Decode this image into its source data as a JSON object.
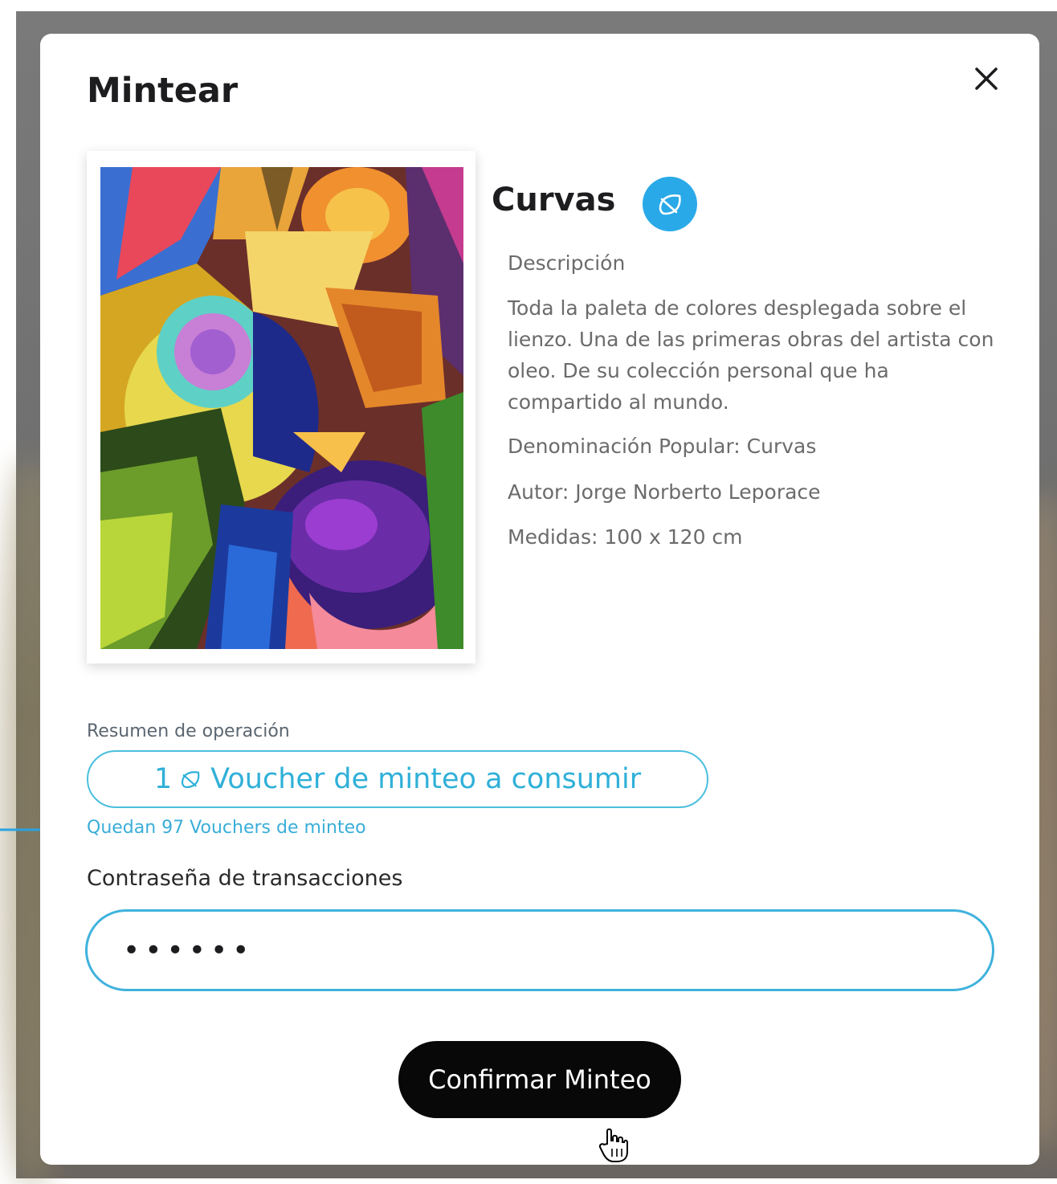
{
  "modal": {
    "title": "Mintear",
    "close_icon": "close-icon"
  },
  "artwork": {
    "name": "Curvas",
    "badge_icon": "leaf-icon",
    "description_label": "Descripción",
    "description": "Toda la paleta de colores desplegada sobre el lienzo. Una de las primeras obras del artista con oleo. De su colección personal que ha compartido al mundo.",
    "popular_name": "Denominación Popular: Curvas",
    "author": "Autor: Jorge Norberto Leporace",
    "dimensions": "Medidas: 100 x 120 cm"
  },
  "summary": {
    "label": "Resumen de operación",
    "voucher_count": "1",
    "voucher_text": "Voucher de minteo a consumir",
    "remaining": "Quedan 97 Vouchers de minteo"
  },
  "password": {
    "label": "Contraseña de transacciones",
    "value": "••••••"
  },
  "actions": {
    "confirm_label": "Confirmar Minteo"
  },
  "colors": {
    "accent": "#29a9e8",
    "button": "#080808"
  }
}
